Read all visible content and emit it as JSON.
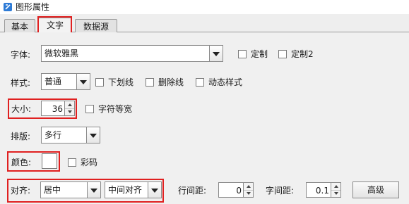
{
  "window": {
    "title": "图形属性"
  },
  "tabs": [
    {
      "label": "基本"
    },
    {
      "label": "文字"
    },
    {
      "label": "数据源"
    }
  ],
  "font": {
    "label": "字体:",
    "value": "微软雅黑",
    "custom1": "定制",
    "custom2": "定制2"
  },
  "style": {
    "label": "样式:",
    "value": "普通",
    "underline": "下划线",
    "strikethrough": "删除线",
    "dynamic": "动态样式"
  },
  "size": {
    "label": "大小:",
    "value": "36",
    "monospace": "字符等宽"
  },
  "layout": {
    "label": "排版:",
    "value": "多行"
  },
  "color": {
    "label": "颜色:",
    "swatch": "#ffffff",
    "barcode_color": "彩码"
  },
  "align": {
    "label": "对齐:",
    "horizontal": "居中",
    "vertical": "中间对齐"
  },
  "line_spacing": {
    "label": "行间距:",
    "value": "0"
  },
  "char_spacing": {
    "label": "字间距:",
    "value": "0.1"
  },
  "advanced_button": "高级",
  "colors": {
    "highlight": "#e02020",
    "panel": "#f0f0f0"
  }
}
